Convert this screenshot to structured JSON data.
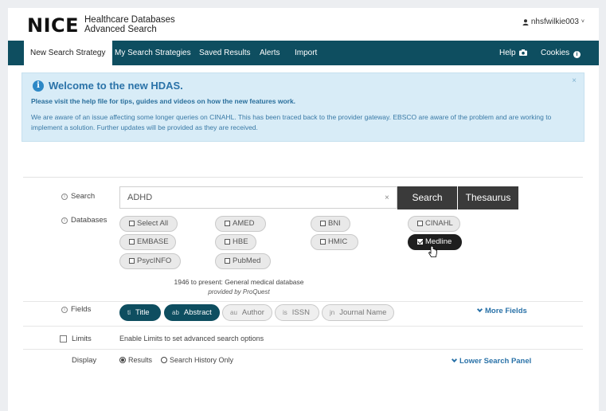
{
  "header": {
    "logo": "NICE",
    "brand_line1": "Healthcare Databases",
    "brand_line2": "Advanced Search",
    "user": "nhsfwilkie003"
  },
  "nav": {
    "items": [
      "New Search Strategy",
      "My Search Strategies",
      "Saved Results",
      "Alerts",
      "Import"
    ],
    "help": "Help",
    "cookies": "Cookies"
  },
  "alert": {
    "title": "Welcome to the new HDAS.",
    "line1": "Please visit the help file for tips, guides and videos on how the new features work.",
    "line2": "We are aware of an issue affecting some longer queries on CINAHL. This has been traced back to the provider gateway. EBSCO are aware of the problem and are working to implement a solution. Further updates will be provided as they are received.",
    "close": "×"
  },
  "search": {
    "label": "Search",
    "value": "ADHD",
    "clear": "×",
    "search_button": "Search",
    "thesaurus_button": "Thesaurus"
  },
  "databases": {
    "label": "Databases",
    "items": [
      {
        "label": "Select All",
        "checked": false
      },
      {
        "label": "AMED",
        "checked": false
      },
      {
        "label": "BNI",
        "checked": false
      },
      {
        "label": "CINAHL",
        "checked": false
      },
      {
        "label": "EMBASE",
        "checked": false
      },
      {
        "label": "HBE",
        "checked": false
      },
      {
        "label": "HMIC",
        "checked": false
      },
      {
        "label": "Medline",
        "checked": true
      },
      {
        "label": "PsycINFO",
        "checked": false
      },
      {
        "label": "PubMed",
        "checked": false
      }
    ],
    "description": "1946 to present: General medical database",
    "provider": "provided by ProQuest"
  },
  "fields": {
    "label": "Fields",
    "items": [
      {
        "abbr": "ti",
        "label": "Title",
        "active": true
      },
      {
        "abbr": "ab",
        "label": "Abstract",
        "active": true
      },
      {
        "abbr": "au",
        "label": "Author",
        "active": false
      },
      {
        "abbr": "is",
        "label": "ISSN",
        "active": false
      },
      {
        "abbr": "jn",
        "label": "Journal Name",
        "active": false
      }
    ],
    "more": "More Fields"
  },
  "limits": {
    "label": "Limits",
    "text": "Enable Limits to set advanced search options"
  },
  "display": {
    "label": "Display",
    "results": "Results",
    "history": "Search History Only",
    "lower_panel": "Lower Search Panel"
  },
  "colors": {
    "nav": "#0e4e60",
    "alert_bg": "#d8ecf7",
    "link": "#2a72a8"
  }
}
